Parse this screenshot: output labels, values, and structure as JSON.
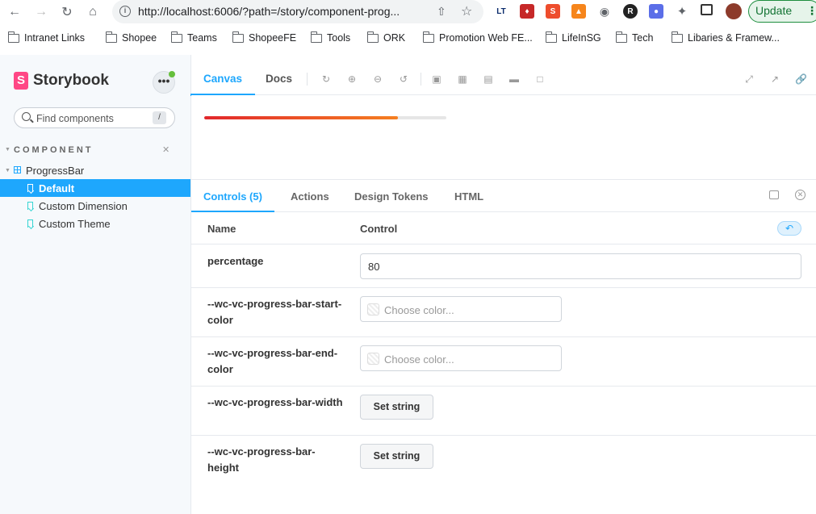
{
  "browser": {
    "url": "http://localhost:6006/?path=/story/component-prog...",
    "update_label": "Update",
    "bookmarks": [
      "Intranet Links",
      "Shopee",
      "Teams",
      "ShopeeFE",
      "Tools",
      "ORK",
      "Promotion Web FE...",
      "LifeInSG",
      "Tech",
      "Libaries & Framew..."
    ]
  },
  "sidebar": {
    "logo_text": "Storybook",
    "search_placeholder": "Find components",
    "search_shortcut": "/",
    "group_label": "COMPONENT",
    "component": "ProgressBar",
    "stories": [
      "Default",
      "Custom Dimension",
      "Custom Theme"
    ],
    "selected_story": "Default"
  },
  "toolbar": {
    "tabs": [
      "Canvas",
      "Docs"
    ],
    "active_tab": "Canvas"
  },
  "preview": {
    "progress_percentage": 80,
    "start_color": "#e2272c",
    "end_color": "#f57f20",
    "track_color": "#e6e6e6"
  },
  "addons": {
    "tabs": [
      "Controls (5)",
      "Actions",
      "Design Tokens",
      "HTML"
    ],
    "active_tab": "Controls (5)"
  },
  "controls": {
    "header_name": "Name",
    "header_control": "Control",
    "rows": [
      {
        "name": "percentage",
        "type": "number",
        "value": "80"
      },
      {
        "name": "--wc-vc-progress-bar-start-color",
        "type": "color",
        "placeholder": "Choose color..."
      },
      {
        "name": "--wc-vc-progress-bar-end-color",
        "type": "color",
        "placeholder": "Choose color..."
      },
      {
        "name": "--wc-vc-progress-bar-width",
        "type": "string",
        "button": "Set string"
      },
      {
        "name": "--wc-vc-progress-bar-height",
        "type": "string",
        "button": "Set string"
      }
    ]
  },
  "theme": {
    "accent": "#1ea7fd",
    "brand": "#ff4785",
    "sidebar_bg": "#f6f9fc"
  }
}
